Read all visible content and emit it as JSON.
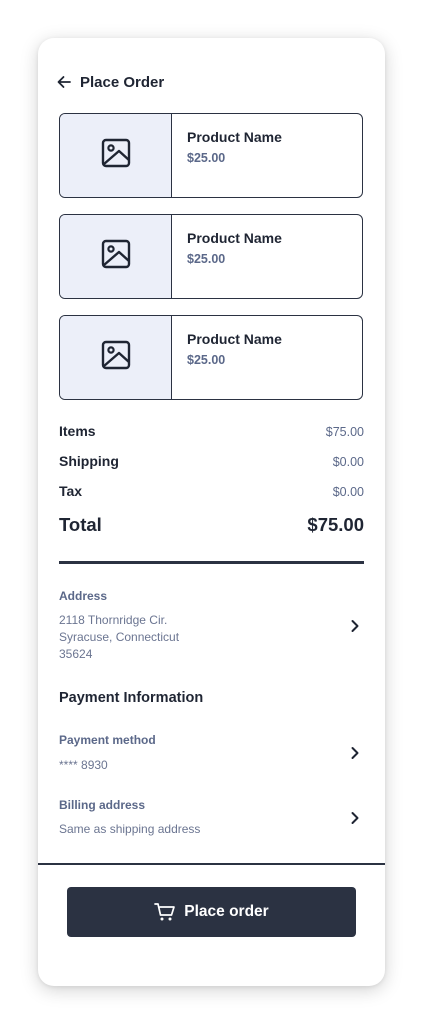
{
  "header": {
    "title": "Place Order",
    "back_icon": "arrow-left-icon"
  },
  "products": [
    {
      "name": "Product Name",
      "price": "$25.00",
      "image_icon": "image-placeholder-icon"
    },
    {
      "name": "Product Name",
      "price": "$25.00",
      "image_icon": "image-placeholder-icon"
    },
    {
      "name": "Product Name",
      "price": "$25.00",
      "image_icon": "image-placeholder-icon"
    }
  ],
  "summary": {
    "items_label": "Items",
    "items_value": "$75.00",
    "shipping_label": "Shipping",
    "shipping_value": "$0.00",
    "tax_label": "Tax",
    "tax_value": "$0.00",
    "total_label": "Total",
    "total_value": "$75.00"
  },
  "address": {
    "label": "Address",
    "line1": "2118 Thornridge Cir.",
    "line2": "Syracuse, Connecticut",
    "line3": "35624"
  },
  "payment": {
    "heading": "Payment Information",
    "method_label": "Payment method",
    "method_value": "**** 8930",
    "billing_label": "Billing address",
    "billing_value": "Same as shipping address"
  },
  "footer": {
    "button_label": "Place order",
    "button_icon": "cart-icon"
  },
  "colors": {
    "primary": "#2b3242",
    "thumb_bg": "#eceff9",
    "muted": "#5b6889"
  }
}
